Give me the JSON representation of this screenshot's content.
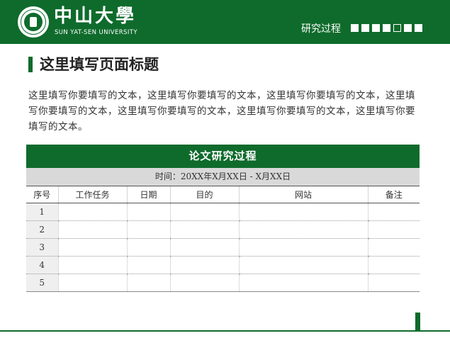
{
  "header": {
    "logo_cn": "中山大學",
    "logo_en": "SUN YAT-SEN UNIVERSITY",
    "nav_label": "研究过程",
    "progress": {
      "total": 7,
      "current_index": 4
    }
  },
  "page": {
    "title": "这里填写页面标题",
    "body_text": "这里填写你要填写的文本，这里填写你要填写的文本，这里填写你要填写的文本，这里填写你要填写的文本，这里填写你要填写的文本，这里填写你要填写的文本，这里填写你要填写的文本。"
  },
  "table": {
    "title": "论文研究过程",
    "subtitle": "时间：20XX年X月XX日 - X月XX日",
    "columns": [
      "序号",
      "工作任务",
      "日期",
      "目的",
      "网站",
      "备注"
    ],
    "rows": [
      [
        "1",
        "",
        "",
        "",
        "",
        ""
      ],
      [
        "2",
        "",
        "",
        "",
        "",
        ""
      ],
      [
        "3",
        "",
        "",
        "",
        "",
        ""
      ],
      [
        "4",
        "",
        "",
        "",
        "",
        ""
      ],
      [
        "5",
        "",
        "",
        "",
        "",
        ""
      ]
    ]
  },
  "colors": {
    "brand_green": "#0f6b2c",
    "subtitle_bg": "#d9d9d9"
  }
}
